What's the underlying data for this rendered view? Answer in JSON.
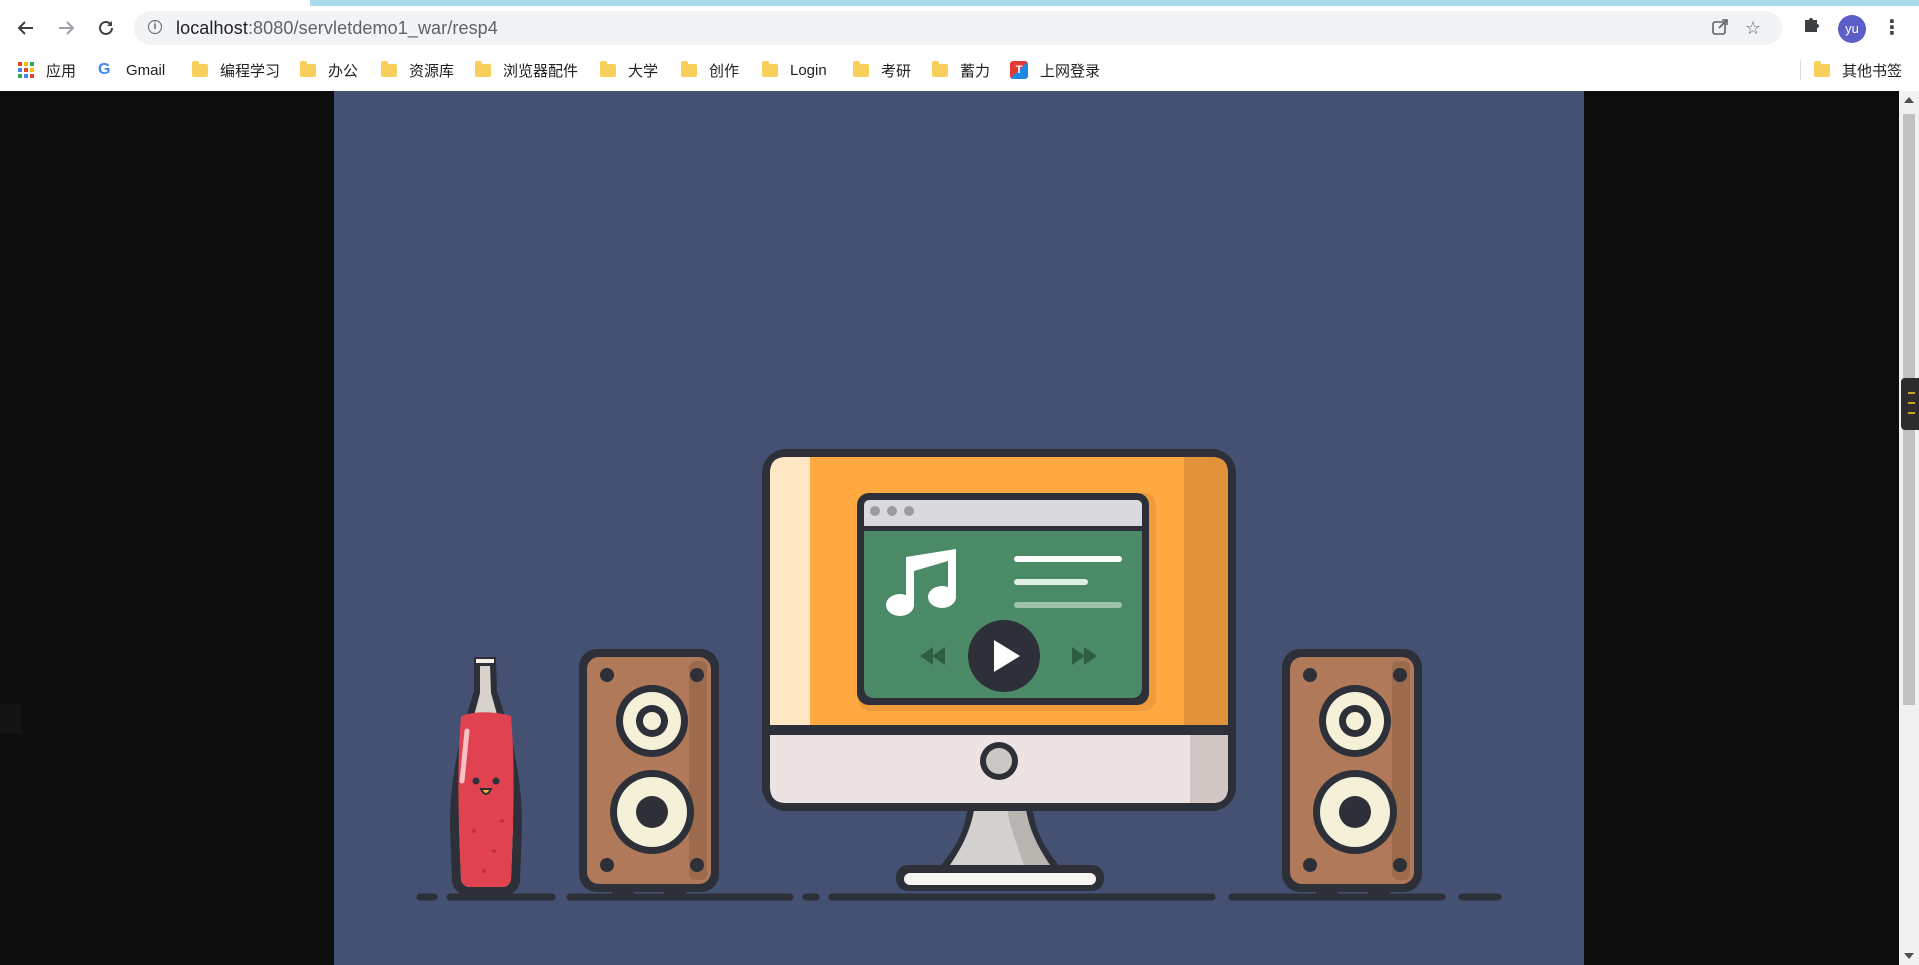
{
  "browser": {
    "url_host": "localhost",
    "url_rest": ":8080/servletdemo1_war/resp4",
    "avatar_text": "yu",
    "icons": {
      "back": "back-arrow-icon",
      "forward": "forward-arrow-icon",
      "reload": "reload-icon",
      "site_info": "info-icon",
      "share": "share-icon",
      "bookmark_star": "star-icon",
      "extensions": "puzzle-icon",
      "menu": "kebab-menu-icon"
    }
  },
  "bookmarks": {
    "items": [
      {
        "label": "应用",
        "icon": "apps-grid-icon"
      },
      {
        "label": "Gmail",
        "icon": "google-icon"
      },
      {
        "label": "编程学习",
        "icon": "folder-icon"
      },
      {
        "label": "办公",
        "icon": "folder-icon"
      },
      {
        "label": "资源库",
        "icon": "folder-icon"
      },
      {
        "label": "浏览器配件",
        "icon": "folder-icon"
      },
      {
        "label": "大学",
        "icon": "folder-icon"
      },
      {
        "label": "创作",
        "icon": "folder-icon"
      },
      {
        "label": "Login",
        "icon": "folder-icon"
      },
      {
        "label": "考研",
        "icon": "folder-icon"
      },
      {
        "label": "蓄力",
        "icon": "folder-icon"
      },
      {
        "label": "上网登录",
        "icon": "cube-app-icon"
      }
    ],
    "other": "其他书签"
  },
  "page": {
    "illustration": "music-desk-illustration",
    "colors": {
      "background": "#445173",
      "side_bars": "#0d0d0d",
      "monitor_frame": "#ffa940",
      "screen_green": "#4b8a66",
      "speaker_wood": "#b07a5a",
      "bottle_red": "#e0434f",
      "outline": "#2d3038"
    }
  }
}
